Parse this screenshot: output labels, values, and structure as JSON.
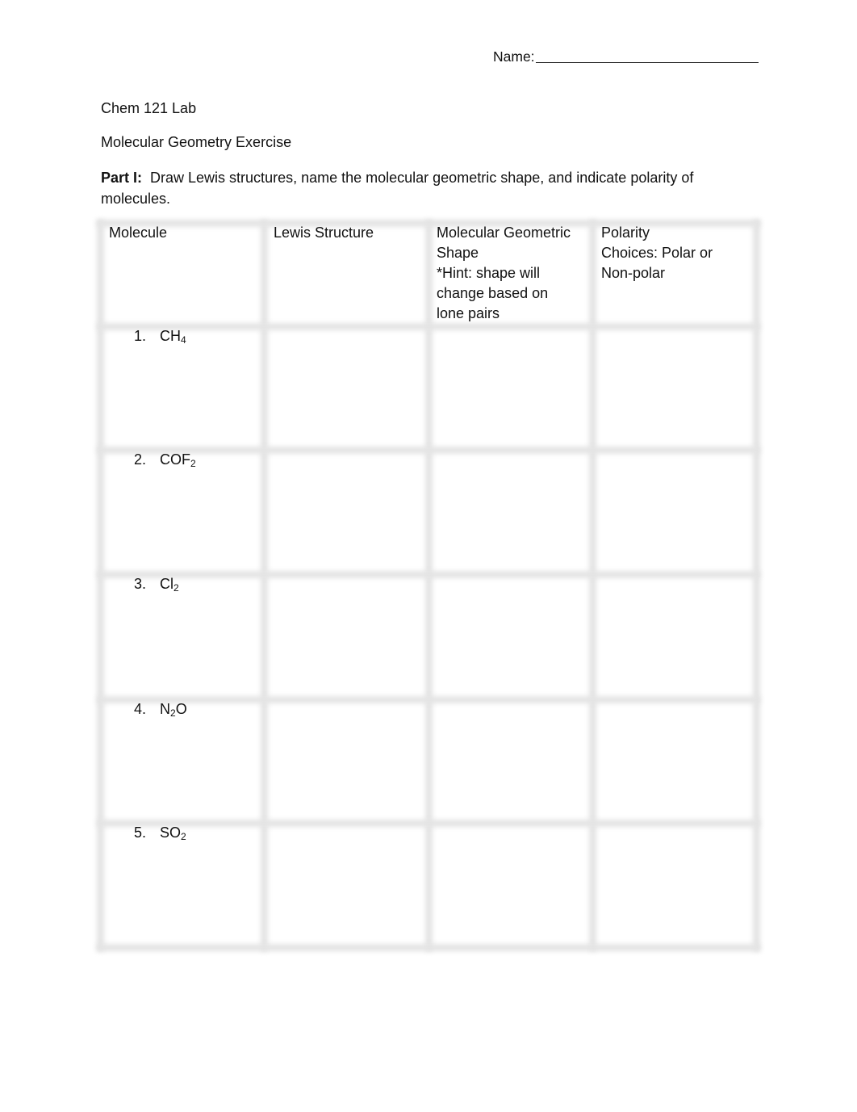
{
  "header": {
    "name_label": "Name:"
  },
  "document": {
    "course": "Chem 121 Lab",
    "title": "Molecular Geometry Exercise",
    "part_label": "Part I:",
    "instructions": "Draw Lewis structures, name the molecular geometric shape, and indicate polarity of molecules."
  },
  "table": {
    "columns": [
      {
        "lines": [
          "Molecule"
        ]
      },
      {
        "lines": [
          "Lewis Structure"
        ]
      },
      {
        "lines": [
          "Molecular Geometric",
          "Shape",
          "*Hint: shape will",
          "change based on",
          "lone pairs"
        ]
      },
      {
        "lines": [
          "Polarity",
          "Choices: Polar or",
          "Non-polar"
        ]
      }
    ],
    "rows": [
      {
        "number": "1.",
        "formula_parts": [
          [
            "CH",
            ""
          ],
          [
            "4",
            "sub"
          ]
        ]
      },
      {
        "number": "2.",
        "formula_parts": [
          [
            "COF",
            ""
          ],
          [
            "2",
            "sub"
          ]
        ]
      },
      {
        "number": "3.",
        "formula_parts": [
          [
            "Cl",
            ""
          ],
          [
            "2",
            "sub"
          ]
        ]
      },
      {
        "number": "4.",
        "formula_parts": [
          [
            "N",
            ""
          ],
          [
            "2",
            "sub"
          ],
          [
            "O",
            ""
          ]
        ]
      },
      {
        "number": "5.",
        "formula_parts": [
          [
            "SO",
            ""
          ],
          [
            "2",
            "sub"
          ]
        ]
      }
    ]
  }
}
